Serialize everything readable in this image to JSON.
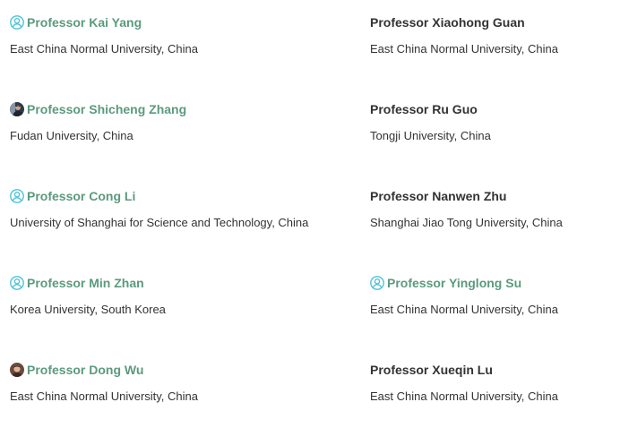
{
  "people": [
    {
      "name": "Professor Kai Yang",
      "affiliation": "East China Normal University, China",
      "linked": true,
      "avatar": "default-user-icon"
    },
    {
      "name": "Professor Xiaohong Guan",
      "affiliation": "East China Normal University, China",
      "linked": false,
      "avatar": ""
    },
    {
      "name": "Professor Shicheng Zhang",
      "affiliation": "Fudan University, China",
      "linked": true,
      "avatar": "photo-avatar"
    },
    {
      "name": "Professor Ru Guo",
      "affiliation": "Tongji University, China",
      "linked": false,
      "avatar": ""
    },
    {
      "name": "Professor Cong Li",
      "affiliation": "University of Shanghai for Science and Technology, China",
      "linked": true,
      "avatar": "default-user-icon"
    },
    {
      "name": "Professor Nanwen Zhu",
      "affiliation": "Shanghai Jiao Tong University, China",
      "linked": false,
      "avatar": ""
    },
    {
      "name": "Professor Min Zhan",
      "affiliation": "Korea University, South Korea",
      "linked": true,
      "avatar": "default-user-icon"
    },
    {
      "name": "Professor Yinglong Su",
      "affiliation": "East China Normal University, China",
      "linked": true,
      "avatar": "default-user-icon"
    },
    {
      "name": "Professor Dong Wu",
      "affiliation": "East China Normal University, China",
      "linked": true,
      "avatar": "photo-avatar"
    },
    {
      "name": "Professor Xueqin Lu",
      "affiliation": "East China Normal University, China",
      "linked": false,
      "avatar": ""
    }
  ],
  "colors": {
    "link": "#5b9a7e",
    "text": "#333333",
    "icon": "#4fc3d9"
  }
}
